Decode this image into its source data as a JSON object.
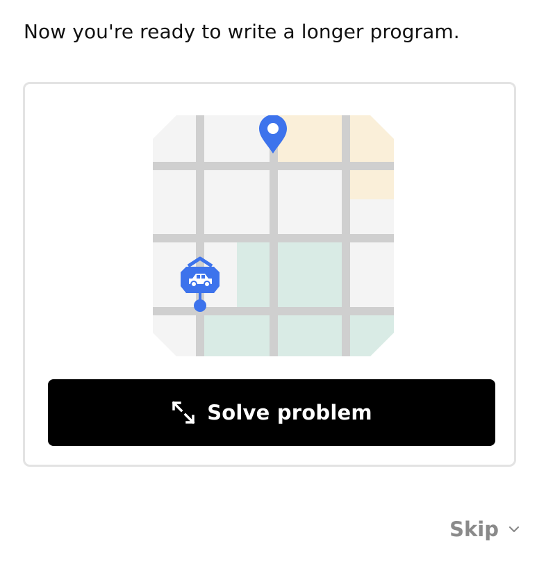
{
  "intro": {
    "text": "Now you're ready to write a longer program."
  },
  "card": {
    "map_icons": {
      "destination": "location-pin-icon",
      "vehicle": "car-icon"
    },
    "solve_button": {
      "label": "Solve problem",
      "icon": "expand-arrows-icon"
    }
  },
  "skip": {
    "label": "Skip",
    "icon": "chevron-down-icon"
  },
  "colors": {
    "accent_blue": "#3d73ec",
    "road": "#cfcfcf",
    "block": "#f4f4f4",
    "park": "#d9ebe5",
    "sand": "#faefd9",
    "button_bg": "#000000",
    "muted_text": "#8a8a8a"
  }
}
